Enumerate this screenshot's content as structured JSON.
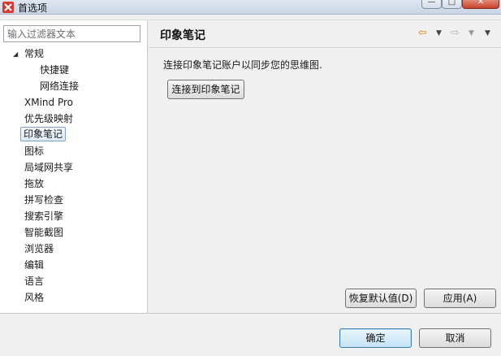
{
  "window": {
    "title": "首选项",
    "min_glyph": "—",
    "max_glyph": "□",
    "close_glyph": "✕"
  },
  "sidebar": {
    "filter_placeholder": "输入过滤器文本",
    "expander_glyph": "◢",
    "items": [
      {
        "label": "常规"
      },
      {
        "label": "快捷键"
      },
      {
        "label": "网络连接"
      },
      {
        "label": "XMind Pro"
      },
      {
        "label": "优先级映射"
      },
      {
        "label": "印象笔记"
      },
      {
        "label": "图标"
      },
      {
        "label": "局域网共享"
      },
      {
        "label": "拖放"
      },
      {
        "label": "拼写检查"
      },
      {
        "label": "搜索引擎"
      },
      {
        "label": "智能截图"
      },
      {
        "label": "浏览器"
      },
      {
        "label": "编辑"
      },
      {
        "label": "语言"
      },
      {
        "label": "风格"
      }
    ],
    "selected": "印象笔记"
  },
  "main": {
    "title": "印象笔记",
    "description": "连接印象笔记账户以同步您的思维图.",
    "connect_button": "连接到印象笔记",
    "restore_defaults_button": "恢复默认值(D)",
    "apply_button": "应用(A)",
    "nav": {
      "back_glyph": "⇦",
      "forward_glyph": "⇨",
      "dropdown_glyph": "▼"
    }
  },
  "footer": {
    "ok_button": "确定",
    "cancel_button": "取消"
  },
  "colors": {
    "accent": "#3c7fb1",
    "selection": "#dcebfc",
    "close": "#c8412a"
  }
}
